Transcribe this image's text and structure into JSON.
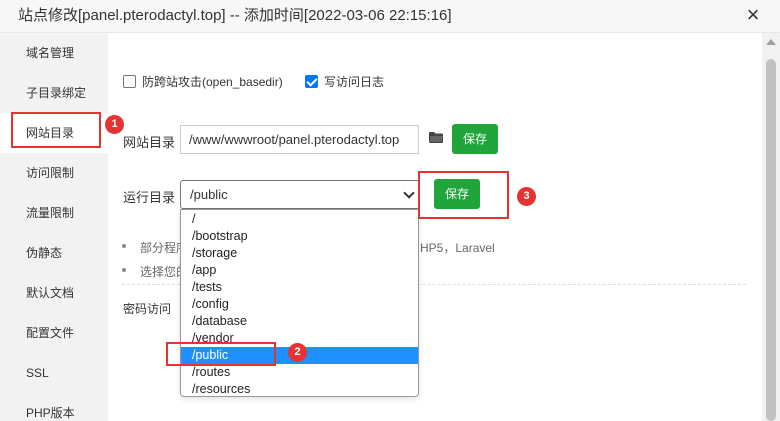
{
  "window": {
    "title": "站点修改[panel.pterodactyl.top] -- 添加时间[2022-03-06 22:15:16]",
    "close_icon": "×"
  },
  "sidebar": {
    "items": [
      {
        "label": "域名管理"
      },
      {
        "label": "子目录绑定"
      },
      {
        "label": "网站目录",
        "active": true
      },
      {
        "label": "访问限制"
      },
      {
        "label": "流量限制"
      },
      {
        "label": "伪静态"
      },
      {
        "label": "默认文档"
      },
      {
        "label": "配置文件"
      },
      {
        "label": "SSL"
      },
      {
        "label": "PHP版本"
      }
    ]
  },
  "options": {
    "anti_cross": {
      "label": "防跨站攻击(open_basedir)",
      "checked": false
    },
    "access_log": {
      "label": "写访问日志",
      "checked": true
    }
  },
  "site_dir": {
    "label": "网站目录",
    "value": "/www/wwwroot/panel.pterodactyl.top",
    "folder_icon": "folder-icon",
    "save_label": "保存"
  },
  "run_dir": {
    "label": "运行目录",
    "selected": "/public",
    "save_label": "保存",
    "options": [
      "/",
      "/bootstrap",
      "/storage",
      "/app",
      "/tests",
      "/config",
      "/database",
      "/vendor",
      "/public",
      "/routes",
      "/resources"
    ],
    "selected_index": 8
  },
  "hints": {
    "line1_start": "部分程序",
    "line1_end": "HP5，Laravel",
    "line2_start": "选择您的"
  },
  "password_access": {
    "label": "密码访问"
  },
  "annotations": {
    "badge1": "1",
    "badge2": "2",
    "badge3": "3"
  },
  "colors": {
    "accent_green": "#20a53a",
    "highlight_blue": "#1e90ff",
    "annotation_red": "#e53333",
    "checkbox_blue": "#0075ff"
  }
}
